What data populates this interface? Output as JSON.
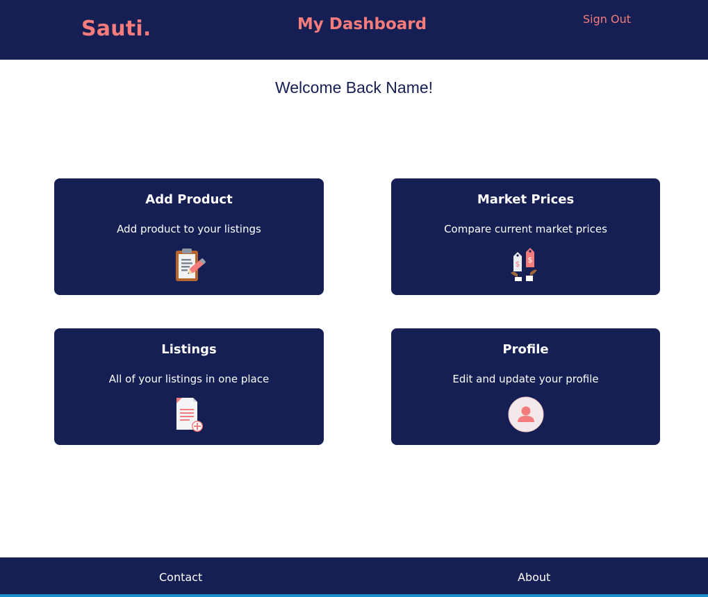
{
  "header": {
    "logo": "Sauti.",
    "title": "My Dashboard",
    "sign_out": "Sign Out"
  },
  "welcome": "Welcome Back Name!",
  "cards": [
    {
      "title": "Add Product",
      "description": "Add product to your listings",
      "icon": "clipboard-edit-icon"
    },
    {
      "title": "Market Prices",
      "description": "Compare current market prices",
      "icon": "price-tags-icon"
    },
    {
      "title": "Listings",
      "description": "All of your listings in one place",
      "icon": "document-add-icon"
    },
    {
      "title": "Profile",
      "description": "Edit and update your profile",
      "icon": "user-avatar-icon"
    }
  ],
  "footer": {
    "contact": "Contact",
    "about": "About"
  },
  "colors": {
    "navy": "#161f53",
    "accent": "#f47c7c",
    "footer_bar": "#1a8fc9"
  }
}
